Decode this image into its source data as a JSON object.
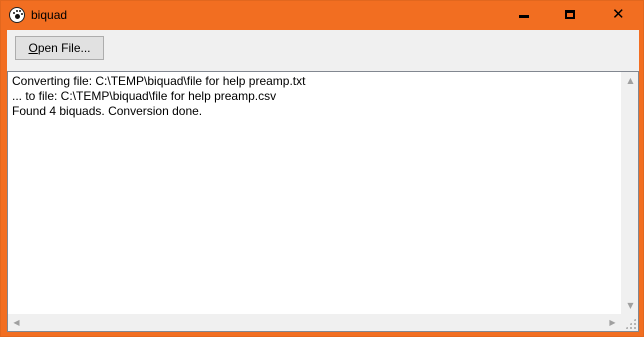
{
  "window": {
    "title": "biquad",
    "frame_color": "#f26e21",
    "icon": "paw-icon"
  },
  "titlebar": {
    "minimize_icon": "minimize-icon",
    "maximize_icon": "maximize-icon",
    "close_icon": "close-icon",
    "close_glyph": "✕"
  },
  "toolbar": {
    "open_label_prefix": "O",
    "open_label_rest": "pen File..."
  },
  "log": {
    "lines": [
      "Converting file: C:\\TEMP\\biquad\\file for help preamp.txt",
      "... to file: C:\\TEMP\\biquad\\file for help preamp.csv",
      "Found 4 biquads. Conversion done."
    ]
  },
  "scrollbars": {
    "up_glyph": "▲",
    "down_glyph": "▼",
    "left_glyph": "◀",
    "right_glyph": "▶"
  }
}
